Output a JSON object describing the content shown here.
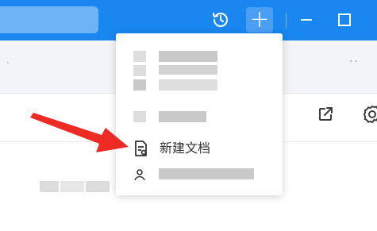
{
  "titlebar": {
    "color": "#1a86f0",
    "icons": [
      "history-icon",
      "plus-icon",
      "minimize-icon",
      "maximize-icon"
    ],
    "add_label": "+"
  },
  "menu": {
    "new_doc_label": "新建文档",
    "new_doc_icon": "document-icon",
    "user_icon": "person-icon"
  },
  "toolbar": {
    "more_label": "··",
    "icons": [
      "share-icon",
      "gear-icon"
    ]
  },
  "annotation": {
    "arrow_color": "#ee2a24"
  }
}
